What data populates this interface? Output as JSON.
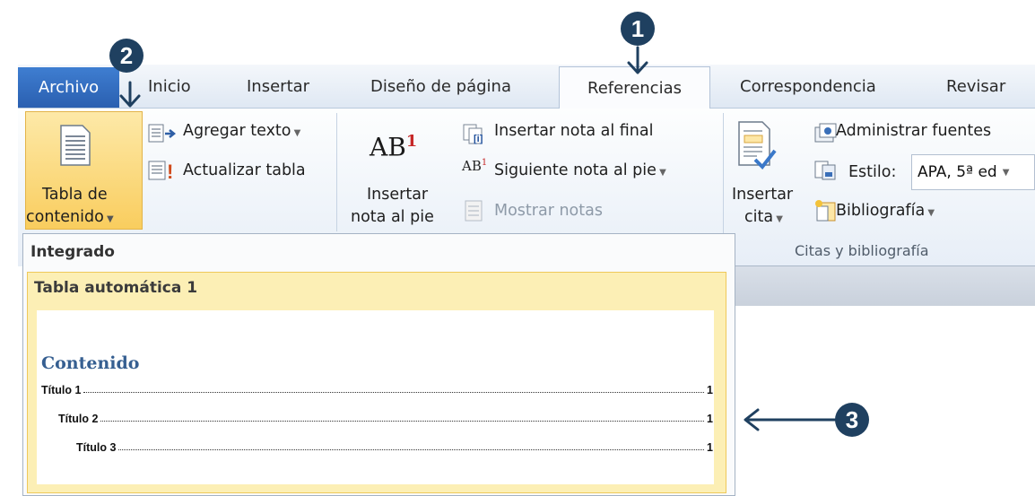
{
  "tabs": {
    "archivo": "Archivo",
    "inicio": "Inicio",
    "insertar": "Insertar",
    "diseno": "Diseño de página",
    "referencias": "Referencias",
    "correspondencia": "Correspondencia",
    "revisar": "Revisar"
  },
  "ribbon": {
    "toc_line1": "Tabla de",
    "toc_line2": "contenido",
    "agregar_texto": "Agregar texto",
    "actualizar_tabla": "Actualizar tabla",
    "insertar_nota_line1": "Insertar",
    "insertar_nota_line2": "nota al pie",
    "ab_glyph": "AB",
    "ab_super": "1",
    "insertar_nota_final": "Insertar nota al final",
    "siguiente_nota": "Siguiente nota al pie",
    "mostrar_notas": "Mostrar notas",
    "insertar_cita_line1": "Insertar",
    "insertar_cita_line2": "cita",
    "administrar_fuentes": "Administrar fuentes",
    "estilo_label": "Estilo:",
    "estilo_value": "APA, 5ª ed",
    "bibliografia": "Bibliografía",
    "group_label": "Citas y bibliografía"
  },
  "gallery": {
    "section": "Integrado",
    "item_title": "Tabla automática 1",
    "heading": "Contenido",
    "entries": [
      {
        "text": "Título 1",
        "page": "1"
      },
      {
        "text": "Título 2",
        "page": "1"
      },
      {
        "text": "Título 3",
        "page": "1"
      }
    ]
  },
  "callouts": [
    "1",
    "2",
    "3"
  ],
  "colors": {
    "archivo_tab": "#2a5fb0",
    "toc_button": "#f9cd5e",
    "callout": "#1f4060",
    "heading": "#365f91"
  }
}
